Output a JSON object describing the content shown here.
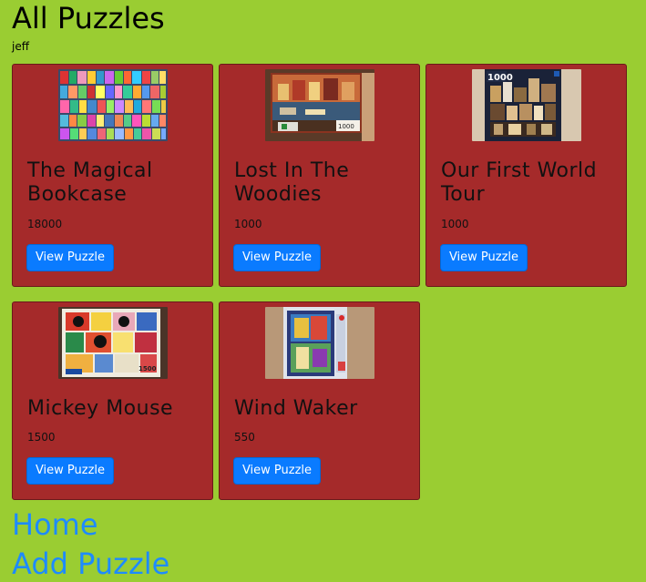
{
  "page": {
    "title": "All Puzzles",
    "username": "jeff"
  },
  "puzzles": [
    {
      "title": "The Magical Bookcase",
      "count": "18000",
      "button": "View Puzzle",
      "image": "bookcase-puzzle-photo"
    },
    {
      "title": "Lost In The Woodies",
      "count": "1000",
      "button": "View Puzzle",
      "image": "woodies-puzzle-box-photo"
    },
    {
      "title": "Our First World Tour",
      "count": "1000",
      "button": "View Puzzle",
      "image": "world-tour-puzzle-box-photo"
    },
    {
      "title": "Mickey Mouse",
      "count": "1500",
      "button": "View Puzzle",
      "image": "mickey-mouse-puzzle-box-photo"
    },
    {
      "title": "Wind Waker",
      "count": "550",
      "button": "View Puzzle",
      "image": "wind-waker-puzzle-box-photo"
    }
  ],
  "nav": {
    "home": "Home",
    "add": "Add Puzzle"
  },
  "colors": {
    "background": "#9acd32",
    "card": "#a52a2a",
    "button": "#0a7bff",
    "link": "#1e8bff"
  }
}
